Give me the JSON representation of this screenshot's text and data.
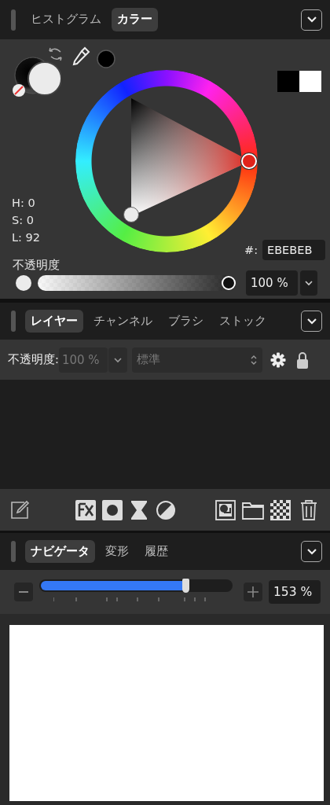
{
  "color_panel": {
    "tabs": [
      {
        "label": "ヒストグラム",
        "selected": false
      },
      {
        "label": "カラー",
        "selected": true
      }
    ],
    "readouts": [
      "H: 0",
      "S: 0",
      "L: 92"
    ],
    "hex_label": "#:",
    "hex_value": "EBEBEB",
    "opacity_label": "不透明度",
    "opacity": {
      "level": 1.0,
      "value": "100 %"
    }
  },
  "layers_panel": {
    "tabs": [
      {
        "label": "レイヤー",
        "selected": true
      },
      {
        "label": "チャンネル",
        "selected": false
      },
      {
        "label": "ブラシ",
        "selected": false
      },
      {
        "label": "ストック",
        "selected": false
      }
    ],
    "opacity_label": "不透明度:",
    "opacity_value": "100 %",
    "blend_mode": "標準",
    "disabled": true
  },
  "navigator_panel": {
    "tabs": [
      {
        "label": "ナビゲータ",
        "selected": true
      },
      {
        "label": "変形",
        "selected": false
      },
      {
        "label": "履歴",
        "selected": false
      }
    ],
    "zoom": {
      "level": 0.76,
      "value": "153 %"
    }
  }
}
